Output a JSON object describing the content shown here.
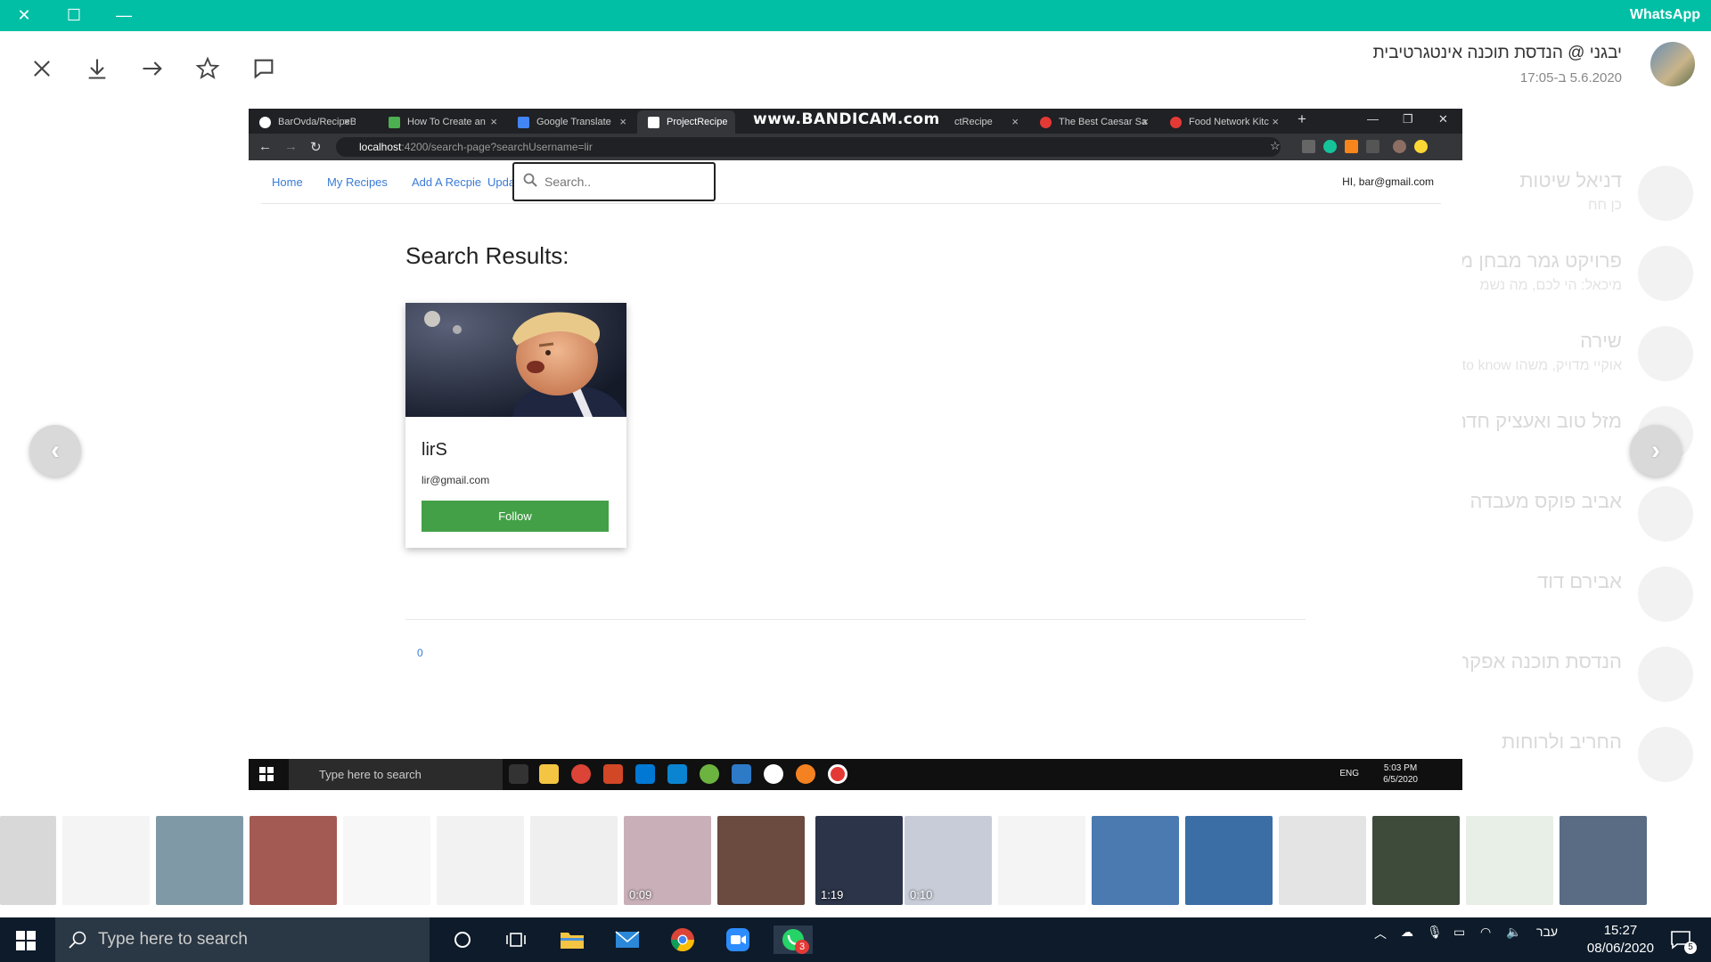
{
  "wa": {
    "app_title": "WhatsApp",
    "sender_name": "יבגני @ הנדסת תוכנה אינטגרטיבית",
    "sender_time": "5.6.2020 ב-17:05"
  },
  "bg_chats": [
    {
      "name": "דניאל שיטות",
      "msg": "כן חח"
    },
    {
      "name": "פרויקט גמר מבחן מ",
      "msg": "מיכאל: הי לכם, מה נשמ"
    },
    {
      "name": "שירה",
      "msg": "אוקיי מדויק, משהו ok to know"
    },
    {
      "name": "מזל טוב ואעציק חדה",
      "msg": ""
    },
    {
      "name": "אביב פוקס מעבדה",
      "msg": ""
    },
    {
      "name": "אבירם דוד",
      "msg": ""
    },
    {
      "name": "הנדסת תוכנה אפקה",
      "msg": ""
    },
    {
      "name": "החריב ולרוחות",
      "msg": ""
    }
  ],
  "browser": {
    "tabs": [
      {
        "label": "BarOvda/RecipeBo",
        "color": "#ffffff"
      },
      {
        "label": "How To Create an",
        "color": "#4caf50"
      },
      {
        "label": "Google Translate",
        "color": "#4285f4"
      },
      {
        "label": "ProjectRecipe",
        "color": "#ffffff"
      },
      {
        "label": "ctRecipe",
        "color": "#ffffff"
      },
      {
        "label": "The Best Caesar Sa",
        "color": "#e53935"
      },
      {
        "label": "Food Network Kitc",
        "color": "#e53935"
      }
    ],
    "watermark": "www.BANDICAM.com",
    "url_host": "localhost",
    "url_path": ":4200/search-page?searchUsername=lir"
  },
  "webpage": {
    "nav": {
      "home": "Home",
      "my_recipes": "My Recipes",
      "add_recipe": "Add A Recpie",
      "update": "Update"
    },
    "search_placeholder": "Search..",
    "greeting": "HI, bar@gmail.com",
    "results_title": "Search Results:",
    "card": {
      "username": "lirS",
      "email": "lir@gmail.com",
      "follow_label": "Follow"
    },
    "pager": "0"
  },
  "inner_taskbar": {
    "search_text": "Type here to search",
    "lang": "ENG",
    "time": "5:03 PM",
    "date": "6/5/2020"
  },
  "thumbnails": [
    {
      "dur": ""
    },
    {
      "dur": ""
    },
    {
      "dur": ""
    },
    {
      "dur": ""
    },
    {
      "dur": ""
    },
    {
      "dur": ""
    },
    {
      "dur": ""
    },
    {
      "dur": "0:09"
    },
    {
      "dur": ""
    },
    {
      "dur": "1:19"
    },
    {
      "dur": "0:10"
    },
    {
      "dur": ""
    },
    {
      "dur": ""
    },
    {
      "dur": ""
    },
    {
      "dur": ""
    },
    {
      "dur": ""
    },
    {
      "dur": ""
    },
    {
      "dur": ""
    }
  ],
  "taskbar": {
    "search_text": "Type here to search",
    "lang": "עבר",
    "time": "15:27",
    "date": "08/06/2020",
    "whatsapp_badge": "3",
    "notif_count": "5"
  }
}
